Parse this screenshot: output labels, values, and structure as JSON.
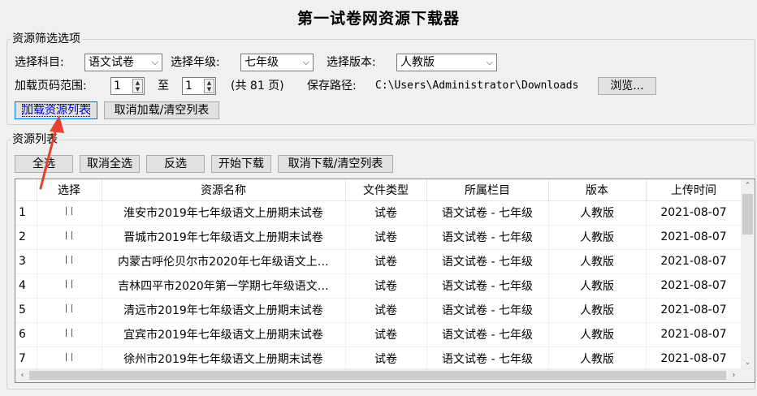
{
  "title": "第一试卷网资源下载器",
  "filter": {
    "legend": "资源筛选选项",
    "subject_label": "选择科目:",
    "subject_value": "语文试卷",
    "grade_label": "选择年级:",
    "grade_value": "七年级",
    "edition_label": "选择版本:",
    "edition_value": "人教版",
    "page_range_label": "加载页码范围:",
    "page_from": "1",
    "to_label": "至",
    "page_to": "1",
    "total_pages": "(共 81 页)",
    "save_path_label": "保存路径:",
    "save_path": "C:\\Users\\Administrator\\Downloads",
    "browse_button": "浏览...",
    "load_button": "加载资源列表",
    "cancel_load_button": "取消加载/清空列表"
  },
  "list": {
    "legend": "资源列表",
    "select_all": "全选",
    "deselect_all": "取消全选",
    "invert": "反选",
    "start_download": "开始下载",
    "cancel_download": "取消下载/清空列表",
    "columns": [
      "",
      "选择",
      "资源名称",
      "文件类型",
      "所属栏目",
      "版本",
      "上传时间"
    ],
    "rows": [
      {
        "n": "1",
        "name": "淮安市2019年七年级语文上册期末试卷",
        "type": "试卷",
        "column": "语文试卷 - 七年级",
        "edition": "人教版",
        "date": "2021-08-07"
      },
      {
        "n": "2",
        "name": "晋城市2019年七年级语文上册期末试卷",
        "type": "试卷",
        "column": "语文试卷 - 七年级",
        "edition": "人教版",
        "date": "2021-08-07"
      },
      {
        "n": "3",
        "name": "内蒙古呼伦贝尔市2020年七年级语文上…",
        "type": "试卷",
        "column": "语文试卷 - 七年级",
        "edition": "人教版",
        "date": "2021-08-07"
      },
      {
        "n": "4",
        "name": "吉林四平市2020年第一学期七年级语文…",
        "type": "试卷",
        "column": "语文试卷 - 七年级",
        "edition": "人教版",
        "date": "2021-08-07"
      },
      {
        "n": "5",
        "name": "清远市2019年七年级语文上册期末试卷",
        "type": "试卷",
        "column": "语文试卷 - 七年级",
        "edition": "人教版",
        "date": "2021-08-07"
      },
      {
        "n": "6",
        "name": "宜宾市2019年七年级语文上册期末试卷",
        "type": "试卷",
        "column": "语文试卷 - 七年级",
        "edition": "人教版",
        "date": "2021-08-07"
      },
      {
        "n": "7",
        "name": "徐州市2019年七年级语文上册期末试卷",
        "type": "试卷",
        "column": "语文试卷 - 七年级",
        "edition": "人教版",
        "date": "2021-08-07"
      }
    ]
  },
  "colors": {
    "annotation_arrow": "#e8402f",
    "focus_border": "#0078d7"
  }
}
